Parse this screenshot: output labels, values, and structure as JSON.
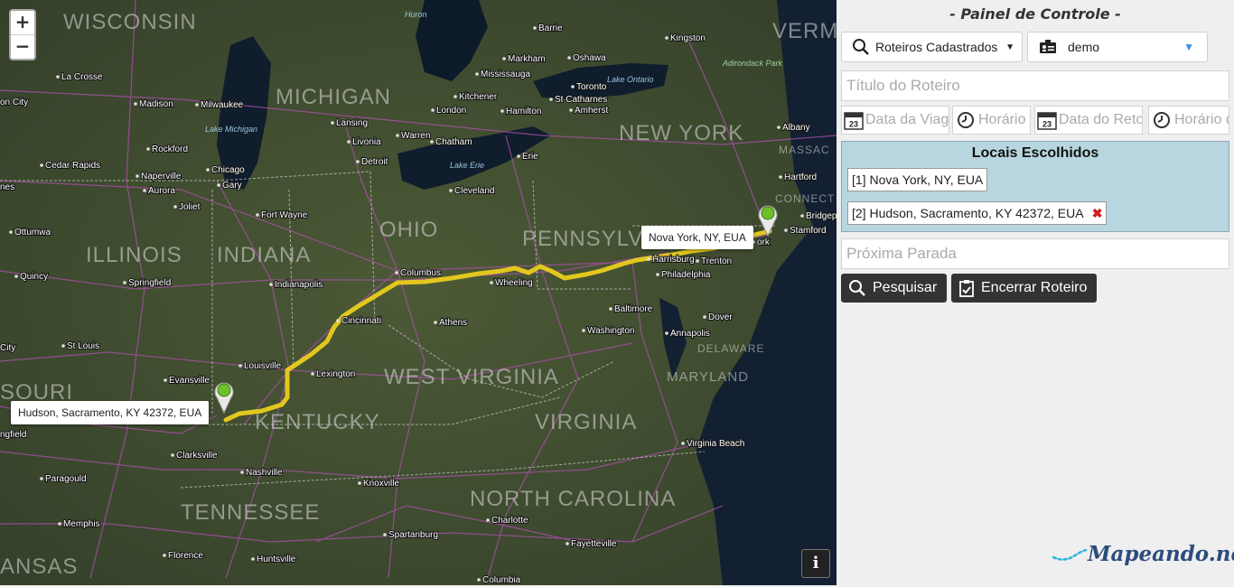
{
  "map": {
    "zoom_in": "+",
    "zoom_out": "−",
    "info": "i",
    "markers": [
      {
        "label": "Nova York, NY, EUA"
      },
      {
        "label": "Hudson, Sacramento, KY 42372, EUA"
      }
    ],
    "state_labels": [
      "WISCONSIN",
      "MICHIGAN",
      "ILLINOIS",
      "INDIANA",
      "OHIO",
      "PENNSYLVANIA",
      "NEW YORK",
      "VERM",
      "WEST VIRGINIA",
      "VIRGINIA",
      "KENTUCKY",
      "TENNESSEE",
      "NORTH CAROLINA",
      "MARYLAND",
      "DELAWARE",
      "MASSAC",
      "CONNECT",
      "SOURI",
      "ANSAS"
    ],
    "water_labels": [
      "Lake Michigan",
      "Lake Erie",
      "Lake Ontario",
      "Huron",
      "Adirondack Park"
    ],
    "city_labels": [
      "Barrie",
      "Kingston",
      "Markham",
      "Oshawa",
      "Mississauga",
      "Toronto",
      "Hamilton",
      "St Catharnes",
      "Amherst",
      "Kitchener",
      "London",
      "Lansing",
      "Livonia",
      "Warren",
      "Chatham",
      "Detroit",
      "Erie",
      "Cleveland",
      "Milwaukee",
      "Madison",
      "La Crosse",
      "Cedar Rapids",
      "Rockford",
      "Naperville",
      "Aurora",
      "Chicago",
      "Gary",
      "Joliet",
      "Fort Wayne",
      "Ottumwa",
      "Quincy",
      "Springfield",
      "Indianapolis",
      "Columbus",
      "Wheeling",
      "Harrisburg",
      "Philadelphia",
      "Trenton",
      "Bridgep",
      "Stamford",
      "Hartford",
      "Albany",
      "Baltimore",
      "Washington",
      "Annapolis",
      "Dover",
      "Cincinnati",
      "Athens",
      "Louisville",
      "Lexington",
      "Evansville",
      "St Louis",
      "Clarksville",
      "Nashville",
      "Knoxville",
      "Paragould",
      "Memphis",
      "Florence",
      "Huntsville",
      "Charlotte",
      "Spartanburg",
      "Fayetteville",
      "Columbia",
      "Virginia Beach",
      "on City",
      "City",
      "ngfield",
      "nes",
      "ork"
    ]
  },
  "panel": {
    "title": "- Painel de Controle -",
    "saved_routes": "Roteiros Cadastrados",
    "user": "demo",
    "route_title_placeholder": "Título do Roteiro",
    "trip_date_placeholder": "Data da Viagem",
    "trip_time_placeholder": "Horário da Viagem",
    "return_date_placeholder": "Data do Retorno",
    "return_time_placeholder": "Horário de Retorno",
    "calendar_day": "23",
    "chosen_title": "Locais Escolhidos",
    "locations": [
      "[1] Nova York, NY, EUA",
      "[2] Hudson, Sacramento, KY 42372, EUA"
    ],
    "next_stop_placeholder": "Próxima Parada",
    "search_button": "Pesquisar",
    "end_button": "Encerrar Roteiro",
    "brand": "Mapeando.net"
  },
  "colors": {
    "route": "#e2c81e",
    "panel_bg": "#efefef",
    "chosen_bg": "#b8d6df",
    "button_bg": "#333333",
    "brand": "#2b4c7e",
    "remove": "#d11a1a"
  }
}
